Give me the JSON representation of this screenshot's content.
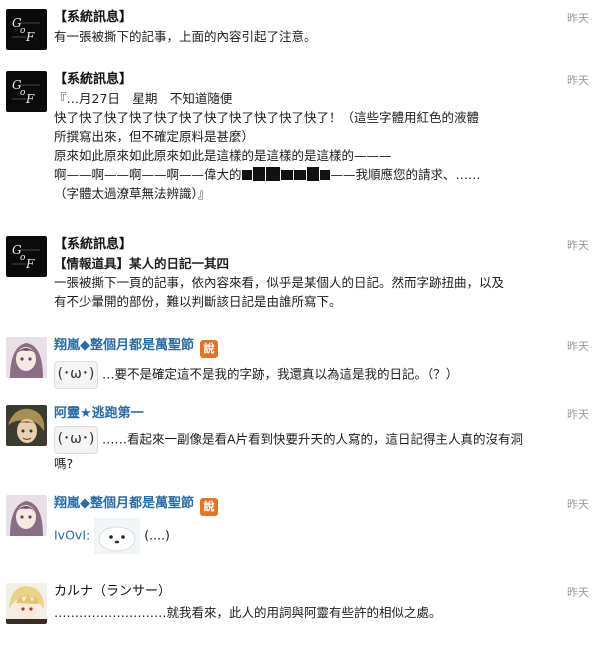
{
  "messages": [
    {
      "sender": "【系統訊息】",
      "time": "昨天",
      "avatar_icon": "gof-logo",
      "lines": [
        "有一張被撕下的記事，上面的內容引起了注意。"
      ]
    },
    {
      "sender": "【系統訊息】",
      "time": "昨天",
      "avatar_icon": "gof-logo",
      "lines": [
        "『…月27日　星期　不知道隨便",
        "快了快了快了快了快了快了快了快了快了快了快了！（這些字體用紅色的液體",
        "所撰寫出來，但不確定原料是甚麼）",
        "原來如此原來如此原來如此是這樣的是這樣的是這樣的———",
        "啊——啊——啊——啊——偉大的",
        "——我順應您的請求、……",
        "（字體太過潦草無法辨識）』"
      ]
    },
    {
      "sender": "【系統訊息】",
      "time": "昨天",
      "avatar_icon": "gof-logo",
      "item_title": "【情報道具】某人的日記一其四",
      "lines": [
        "一張被撕下一頁的記事，依內容來看，似乎是某個人的日記。然而字跡扭曲，以及",
        "有不少暈開的部份，難以判斷該日記是由誰所寫下。"
      ]
    },
    {
      "sender": "翔嵐◆整個月都是萬聖節",
      "time": "昨天",
      "badge": "說",
      "avatar_icon": "user-avatar-girl",
      "sticker": "(･ω･)",
      "text": "…要不是確定這不是我的字跡，我還真以為這是我的日記。（？）"
    },
    {
      "sender": "阿靈★逃跑第一",
      "time": "昨天",
      "avatar_icon": "user-avatar-boy",
      "sticker": "(･ω･)",
      "text": "……看起來一副像是看A片看到快要升天的人寫的，這日記得主人真的沒有洞",
      "text2": "嗎?"
    },
    {
      "sender": "翔嵐◆整個月都是萬聖節",
      "time": "昨天",
      "badge": "說",
      "avatar_icon": "user-avatar-girl",
      "prefix": "IvOvI:",
      "suffix": "(....)"
    },
    {
      "sender": "カルナ（ランサー）",
      "time": "昨天",
      "avatar_icon": "user-avatar-blond",
      "text": "………………………就我看來，此人的用詞與阿靈有些許的相似之處。"
    }
  ]
}
